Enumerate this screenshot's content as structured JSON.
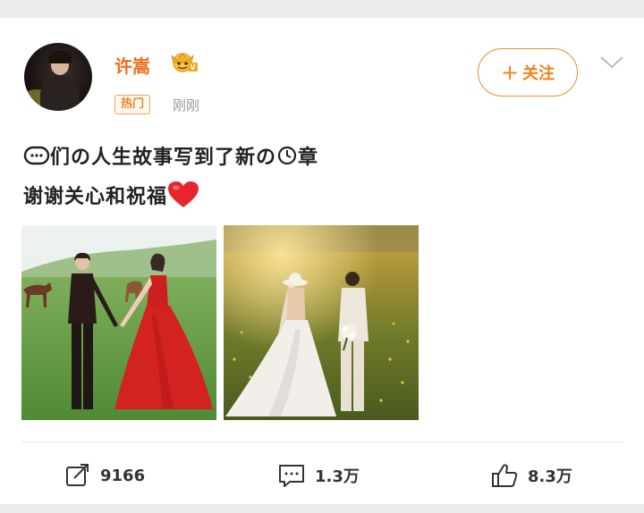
{
  "post": {
    "username": "许嵩",
    "hot_tag": "热门",
    "time": "刚刚",
    "follow_label": "关注",
    "text_line1_parts": [
      "们の人生故事写到了新の",
      "章"
    ],
    "text_line2": "谢谢关心和祝福"
  },
  "actions": {
    "repost_count": "9166",
    "comment_count": "1.3万",
    "like_count": "8.3万"
  },
  "icons": {
    "vip": "vip-crown-icon",
    "chevron": "chevron-down-icon",
    "repost": "repost-icon",
    "comment": "comment-icon",
    "like": "thumbs-up-icon",
    "heart": "red-heart-emoji",
    "face": "emoji-face-icon",
    "clock": "clock-emoji-icon"
  },
  "colors": {
    "accent": "#f26b1d",
    "follow": "#f0831e",
    "heart": "#e8252f"
  }
}
